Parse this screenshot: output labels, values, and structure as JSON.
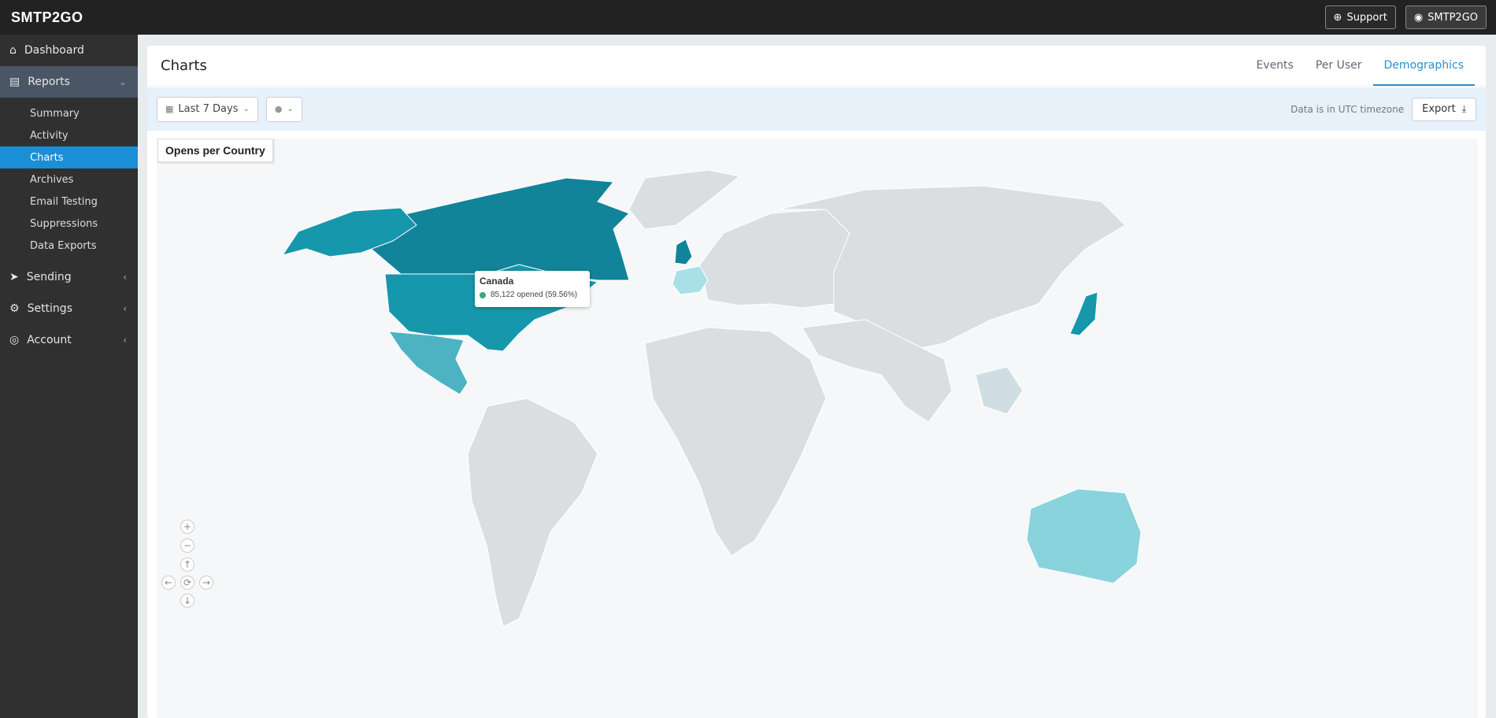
{
  "topbar": {
    "logo": "SMTP2GO",
    "support_label": "Support",
    "account_label": "SMTP2GO"
  },
  "sidebar": {
    "dashboard": "Dashboard",
    "reports": "Reports",
    "reports_items": [
      "Summary",
      "Activity",
      "Charts",
      "Archives",
      "Email Testing",
      "Suppressions",
      "Data Exports"
    ],
    "sending": "Sending",
    "settings": "Settings",
    "account": "Account"
  },
  "page": {
    "title": "Charts",
    "tabs": [
      "Events",
      "Per User",
      "Demographics"
    ],
    "active_tab": "Demographics"
  },
  "filters": {
    "date_range": "Last 7 Days",
    "timezone_note": "Data is in UTC timezone",
    "export_label": "Export"
  },
  "map": {
    "title": "Opens per Country",
    "tooltip": {
      "country": "Canada",
      "value_text": "85,122 opened (59.56%)",
      "dot_color": "#3aa87a"
    },
    "colors": {
      "high": "#11849a",
      "mid": "#1697ac",
      "low": "#4db3c3",
      "light": "#89d3dd",
      "lighter": "#a8e0e8",
      "minimal": "#d0dde2",
      "none": "#dadee1"
    },
    "controls": {
      "zoom_in": "+",
      "zoom_out": "−",
      "up": "↑",
      "left": "←",
      "reset": "⟳",
      "right": "→",
      "down": "↓"
    }
  }
}
